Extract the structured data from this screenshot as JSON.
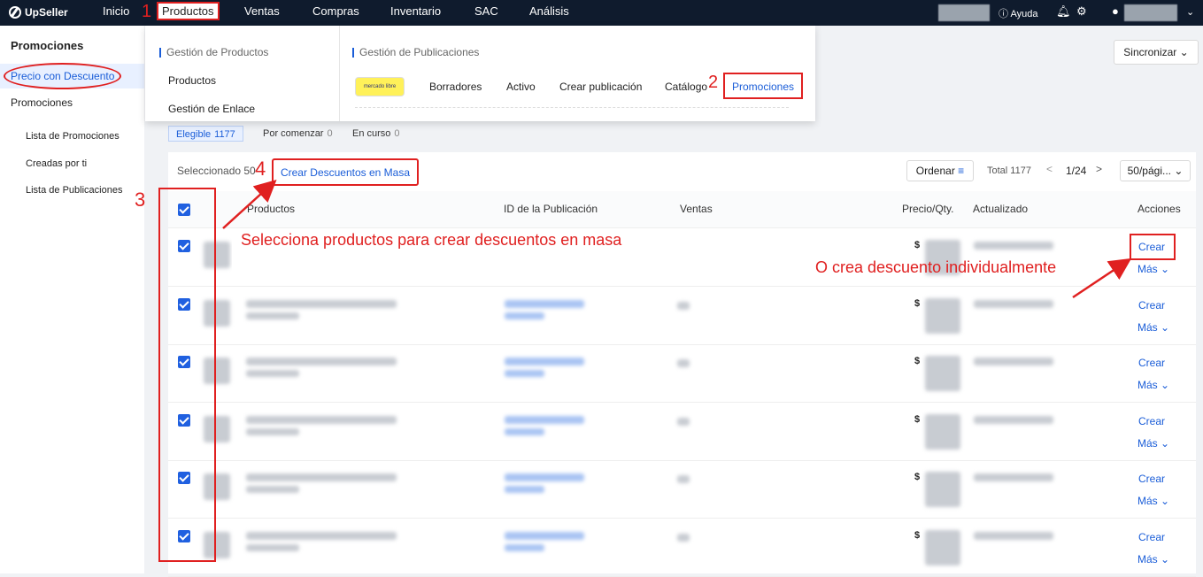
{
  "topbar": {
    "logo": "UpSeller",
    "nav": [
      "Inicio",
      "Productos",
      "Ventas",
      "Compras",
      "Inventario",
      "SAC",
      "Análisis"
    ],
    "help": "Ayuda"
  },
  "sidebar": {
    "title": "Promociones",
    "items": [
      "Precio con Descuento",
      "Promociones"
    ],
    "subitems": [
      "Lista de Promociones",
      "Creadas por ti",
      "Lista de Publicaciones"
    ]
  },
  "dropdown": {
    "left_heading": "Gestión de Productos",
    "left_links": [
      "Productos",
      "Gestión de Enlace"
    ],
    "right_heading": "Gestión de Publicaciones",
    "marketplace_logo": "mercado libre",
    "right_links": [
      "Borradores",
      "Activo",
      "Crear publicación",
      "Catálogo",
      "Promociones"
    ]
  },
  "sync_button": "Sincronizar",
  "tabs": [
    {
      "label": "Elegible",
      "count": "1177"
    },
    {
      "label": "Por comenzar",
      "count": "0"
    },
    {
      "label": "En curso",
      "count": "0"
    }
  ],
  "toolbar": {
    "selected_label": "Seleccionado 50",
    "bulk_button": "Crear Descuentos en Masa",
    "sort_button": "Ordenar",
    "total": "Total 1177",
    "page": "1/24",
    "page_size": "50/pági..."
  },
  "table": {
    "headers": [
      "Productos",
      "ID de la Publicación",
      "Ventas",
      "Precio/Qty.",
      "Actualizado",
      "Acciones"
    ],
    "currency": "$",
    "row_actions": {
      "create": "Crear",
      "more": "Más"
    },
    "row_count": 6
  },
  "annotations": {
    "step1": "1",
    "step2": "2",
    "step3": "3",
    "step4": "4",
    "bulk_hint": "Selecciona productos para crear descuentos en masa",
    "single_hint": "O crea descuento individualmente"
  },
  "colors": {
    "accent": "#1a5dd8",
    "annotation": "#e02020",
    "topbar": "#0f1b2d"
  }
}
